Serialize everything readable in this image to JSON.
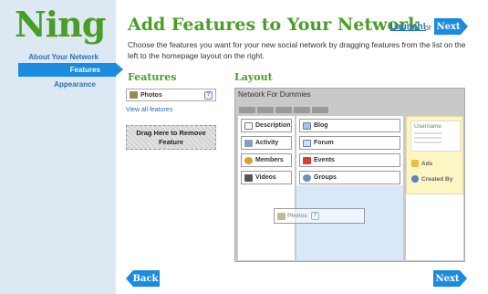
{
  "sidebar": {
    "logo": "Ning",
    "items": [
      {
        "label": "About Your Network"
      },
      {
        "label": "Features"
      },
      {
        "label": "Appearance"
      }
    ]
  },
  "header": {
    "title": "Add Features to Your Network",
    "intro": "Choose the features you want for your new social network by dragging features from the list on the left to the homepage layout on the right.",
    "launch_label": "Launch!",
    "or_label": "or",
    "next_label": "Next"
  },
  "features_panel": {
    "heading": "Features",
    "items": [
      {
        "label": "Photos",
        "icon": "photo-icon"
      }
    ],
    "help_glyph": "?",
    "view_all_label": "View all features",
    "remove_zone_label": "Drag Here to Remove Feature"
  },
  "layout_panel": {
    "heading": "Layout",
    "network_name": "Network For Dummies",
    "tab_count": 5,
    "left_column": [
      {
        "label": "Description",
        "icon": "description-icon"
      },
      {
        "label": "Activity",
        "icon": "activity-icon"
      },
      {
        "label": "Members",
        "icon": "members-icon"
      },
      {
        "label": "Videos",
        "icon": "videos-icon"
      }
    ],
    "middle_column": [
      {
        "label": "Blog",
        "icon": "blog-icon"
      },
      {
        "label": "Forum",
        "icon": "forum-icon"
      },
      {
        "label": "Events",
        "icon": "events-icon"
      },
      {
        "label": "Groups",
        "icon": "groups-icon"
      }
    ],
    "right_column": {
      "username_label": "Username",
      "items": [
        {
          "label": "Ads",
          "icon": "ads-icon"
        },
        {
          "label": "Created By",
          "icon": "info-icon"
        }
      ]
    },
    "dragging_item": {
      "label": "Photos",
      "icon": "photo-icon"
    }
  },
  "footer": {
    "back_label": "Back",
    "next_label": "Next"
  },
  "colors": {
    "brand_green": "#4a9e28",
    "accent_blue": "#1b8ae0",
    "sidebar_bg": "#dde9f2",
    "drop_zone_blue": "#d9e8f8",
    "right_column_yellow": "#fbf6c4"
  }
}
